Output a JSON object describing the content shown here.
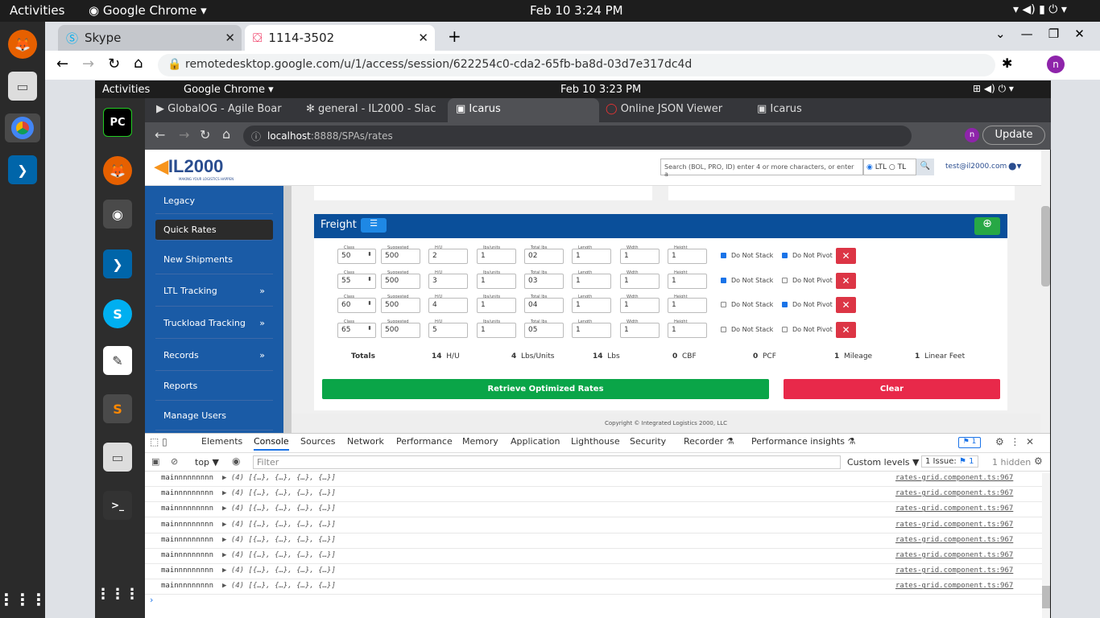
{
  "os": {
    "activities": "Activities",
    "app": "Google Chrome",
    "clock": "Feb 10   3:24 PM"
  },
  "outer_tabs": [
    "Skype",
    "1114-3502"
  ],
  "outer_url": "remotedesktop.google.com/u/1/access/session/622254c0-cda2-65fb-ba8d-03d7e317dc4d",
  "inner_os": {
    "activities": "Activities",
    "app": "Google Chrome",
    "clock": "Feb 10   3:23 PM"
  },
  "inner_tabs": [
    "GlobalOG - Agile Boar",
    "general - IL2000 - Slac",
    "Icarus",
    "Online JSON Viewer",
    "Icarus"
  ],
  "inner_url": {
    "host": "localhost",
    "rest": ":8888/SPAs/rates"
  },
  "update_label": "Update",
  "avatar_letter": "n",
  "app": {
    "logo": "IL2000",
    "logo_tagline": "MAKING YOUR LOGISTICS HAPPEN",
    "search_placeholder": "Search (BOL, PRO, ID) enter 4 or more characters, or enter a",
    "ltl": "LTL",
    "tl": "TL",
    "user": "test@il2000.com",
    "sidebar": [
      "Legacy",
      "Quick Rates",
      "New Shipments",
      "LTL Tracking",
      "Truckload Tracking",
      "Records",
      "Reports",
      "Manage Users"
    ],
    "freight_title": "Freight",
    "field_labels": [
      "Class",
      "Suggested",
      "H/U",
      "lbs/units",
      "Total lbs",
      "Length",
      "Width",
      "Height"
    ],
    "rows": [
      {
        "class": "50",
        "suggested": "500",
        "hu": "2",
        "lbs": "1",
        "total": "02",
        "length": "1",
        "width": "1",
        "height": "1",
        "stack": true,
        "pivot": true
      },
      {
        "class": "55",
        "suggested": "500",
        "hu": "3",
        "lbs": "1",
        "total": "03",
        "length": "1",
        "width": "1",
        "height": "1",
        "stack": true,
        "pivot": false
      },
      {
        "class": "60",
        "suggested": "500",
        "hu": "4",
        "lbs": "1",
        "total": "04",
        "length": "1",
        "width": "1",
        "height": "1",
        "stack": false,
        "pivot": true
      },
      {
        "class": "65",
        "suggested": "500",
        "hu": "5",
        "lbs": "1",
        "total": "05",
        "length": "1",
        "width": "1",
        "height": "1",
        "stack": false,
        "pivot": false
      }
    ],
    "do_not_stack": "Do Not Stack",
    "do_not_pivot": "Do Not Pivot",
    "totals": {
      "label": "Totals",
      "hu": "14",
      "hu_u": "H/U",
      "lbs_units": "4",
      "lbs_units_u": "Lbs/Units",
      "lbs": "14",
      "lbs_u": "Lbs",
      "cbf": "0",
      "cbf_u": "CBF",
      "pcf": "0",
      "pcf_u": "PCF",
      "mileage": "1",
      "mileage_u": "Mileage",
      "linear": "1",
      "linear_u": "Linear Feet"
    },
    "retrieve": "Retrieve Optimized Rates",
    "clear": "Clear",
    "copyright": "Copyright © Integrated Logistics 2000, LLC"
  },
  "devtools": {
    "tabs": [
      "Elements",
      "Console",
      "Sources",
      "Network",
      "Performance",
      "Memory",
      "Application",
      "Lighthouse",
      "Security",
      "Recorder ⚗",
      "Performance insights ⚗"
    ],
    "issues_badge": "1",
    "context": "top ▼",
    "filter_placeholder": "Filter",
    "levels": "Custom levels ▼",
    "issue_count": "1 Issue:",
    "issue_badge2": "1",
    "hidden": "1 hidden",
    "log_text": "mainnnnnnnnn",
    "log_obj": "▶ (4) [{…}, {…}, {…}, {…}]",
    "log_src": "rates-grid.component.ts:967",
    "log_count": 8
  }
}
